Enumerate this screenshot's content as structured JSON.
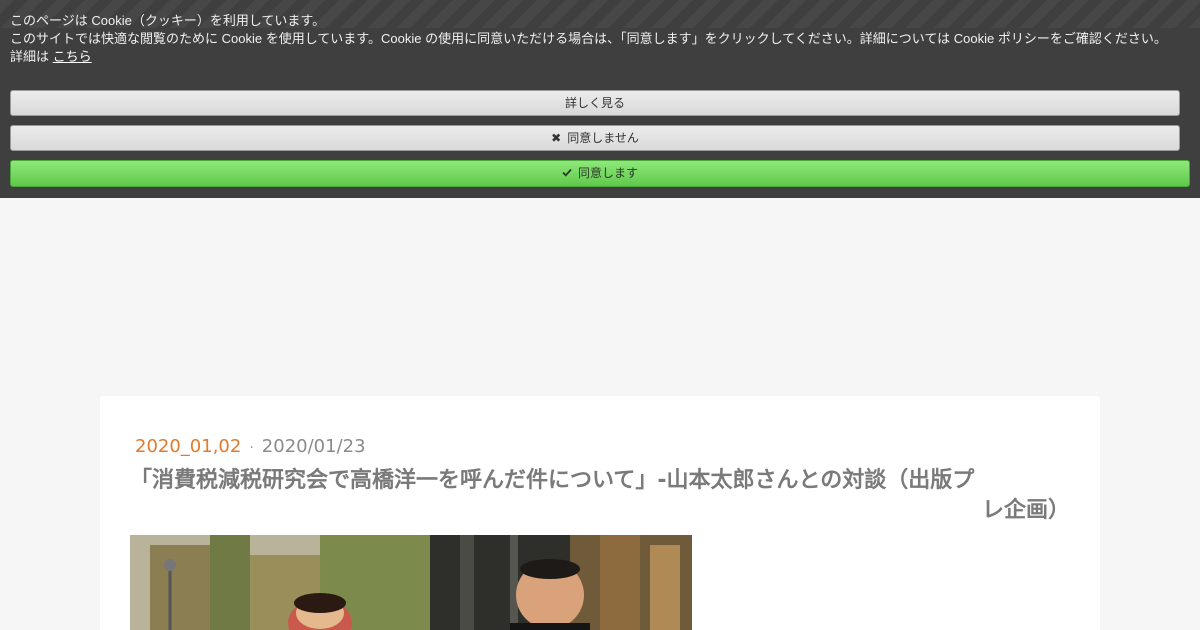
{
  "cookie": {
    "line1": "このページは Cookie（クッキー）を利用しています。",
    "line2": "このサイトでは快適な閲覧のために Cookie を使用しています。Cookie の使用に同意いただける場合は、「同意します」をクリックしてください。詳細については Cookie ポリシーをご確認ください。",
    "details_prefix": "詳細は",
    "details_link": "こちら",
    "more_label": "詳しく見る",
    "decline_label": "同意しません",
    "decline_icon": "✖",
    "accept_label": "同意します",
    "accept_icon": "✔",
    "colors": {
      "banner": "#3f3f3f",
      "accept": "#6fd55b",
      "neutral": "#e0e0e0"
    }
  },
  "post": {
    "category": "2020_01,02",
    "separator": "·",
    "date": "2020/01/23",
    "title_line1": "「消費税減税研究会で高橋洋一を呼んだ件について」-山本太郎さんとの対談（出版プ",
    "title_line2": "レ企画）",
    "colors": {
      "category": "#e07a2e",
      "title": "#7a7a7a"
    }
  }
}
